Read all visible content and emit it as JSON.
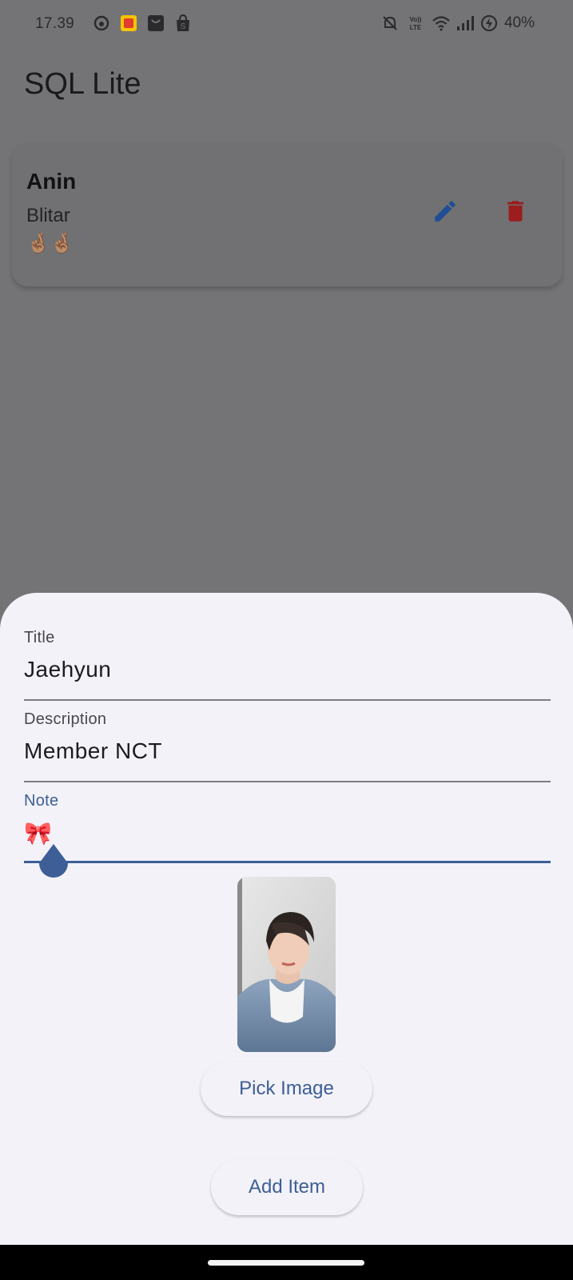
{
  "status_bar": {
    "time": "17.39",
    "battery": "40%",
    "left_icons": [
      "face-icon",
      "app-badge-icon",
      "bag-icon",
      "shopee-icon"
    ],
    "right_icons": [
      "mute-icon",
      "volte-icon",
      "wifi-icon",
      "signal-icon",
      "charging-icon"
    ]
  },
  "app_bar": {
    "title": "SQL Lite"
  },
  "items": [
    {
      "title": "Anin",
      "description": "Blitar",
      "note": "🤞🏽🤞🏽"
    }
  ],
  "colors": {
    "edit_icon": "#1f4e96",
    "delete_icon": "#9b1d1d",
    "accent": "#3d5e96",
    "scrim": "#747476",
    "sheet_bg": "#f2f2f8"
  },
  "form": {
    "title_label": "Title",
    "title_value": "Jaehyun",
    "description_label": "Description",
    "description_value": "Member NCT",
    "note_label": "Note",
    "note_value": "🎀"
  },
  "buttons": {
    "pick_image": "Pick Image",
    "add_item": "Add Item"
  }
}
